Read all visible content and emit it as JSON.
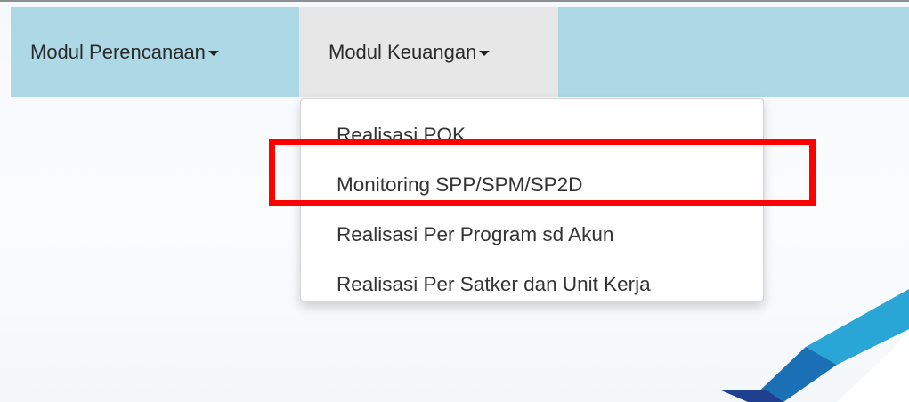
{
  "navbar": {
    "items": [
      {
        "label": "Modul Perencanaan"
      },
      {
        "label": "Modul Keuangan",
        "active": true
      }
    ]
  },
  "dropdown": {
    "items": [
      {
        "label": "Realisasi POK"
      },
      {
        "label": "Monitoring SPP/SPM/SP2D",
        "highlighted": true
      },
      {
        "label": "Realisasi Per Program sd Akun"
      },
      {
        "label": "Realisasi Per Satker dan Unit Kerja"
      }
    ]
  },
  "colors": {
    "navbar_background": "#add8e6",
    "active_tab_background": "#e7e7e7",
    "highlight_border": "#ff0000",
    "decor_blue_dark": "#1f3f8f",
    "decor_blue_mid": "#1a6fb5",
    "decor_blue_light": "#2aa6d6"
  },
  "icons": {
    "nav_caret": "caret-down-icon"
  }
}
